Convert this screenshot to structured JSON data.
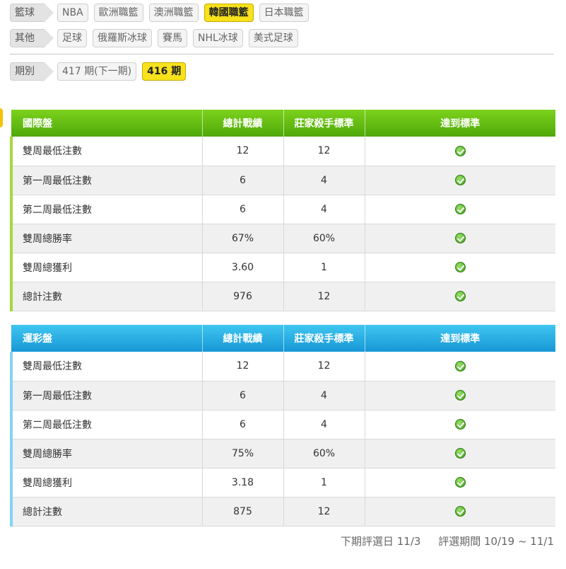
{
  "filters": {
    "basketball": {
      "label": "籃球",
      "items": [
        {
          "label": "NBA",
          "active": false
        },
        {
          "label": "歐洲職籃",
          "active": false
        },
        {
          "label": "澳洲職籃",
          "active": false
        },
        {
          "label": "韓國職籃",
          "active": true
        },
        {
          "label": "日本職籃",
          "active": false
        }
      ]
    },
    "other": {
      "label": "其他",
      "items": [
        {
          "label": "足球",
          "active": false
        },
        {
          "label": "俄羅斯冰球",
          "active": false
        },
        {
          "label": "賽馬",
          "active": false
        },
        {
          "label": "NHL冰球",
          "active": false
        },
        {
          "label": "美式足球",
          "active": false
        }
      ]
    },
    "period": {
      "label": "期別",
      "items": [
        {
          "label": "417 期(下一期)",
          "active": false
        },
        {
          "label": "416 期",
          "active": true
        }
      ]
    }
  },
  "tables": [
    {
      "name": "國際盤",
      "headers": [
        "國際盤",
        "總計戰績",
        "莊家殺手標準",
        "達到標準"
      ],
      "rows": [
        {
          "label": "雙周最低注數",
          "record": "12",
          "standard": "12",
          "met": true
        },
        {
          "label": "第一周最低注數",
          "record": "6",
          "standard": "4",
          "met": true
        },
        {
          "label": "第二周最低注數",
          "record": "6",
          "standard": "4",
          "met": true
        },
        {
          "label": "雙周總勝率",
          "record": "67%",
          "standard": "60%",
          "met": true
        },
        {
          "label": "雙周總獲利",
          "record": "3.60",
          "standard": "1",
          "met": true
        },
        {
          "label": "總計注數",
          "record": "976",
          "standard": "12",
          "met": true
        }
      ]
    },
    {
      "name": "運彩盤",
      "headers": [
        "運彩盤",
        "總計戰績",
        "莊家殺手標準",
        "達到標準"
      ],
      "rows": [
        {
          "label": "雙周最低注數",
          "record": "12",
          "standard": "12",
          "met": true
        },
        {
          "label": "第一周最低注數",
          "record": "6",
          "standard": "4",
          "met": true
        },
        {
          "label": "第二周最低注數",
          "record": "6",
          "standard": "4",
          "met": true
        },
        {
          "label": "雙周總勝率",
          "record": "75%",
          "standard": "60%",
          "met": true
        },
        {
          "label": "雙周總獲利",
          "record": "3.18",
          "standard": "1",
          "met": true
        },
        {
          "label": "總計注數",
          "record": "875",
          "standard": "12",
          "met": true
        }
      ]
    }
  ],
  "footer": {
    "next_selection": "下期評選日 11/3",
    "selection_period": "評選期間 10/19 ~ 11/1"
  },
  "colors": {
    "active_chip": "#f7e21b",
    "table1_header": "#5db812",
    "table2_header": "#23a8e0",
    "check_icon": "#4caf24"
  },
  "icons": {
    "met": "check-circle-icon"
  }
}
